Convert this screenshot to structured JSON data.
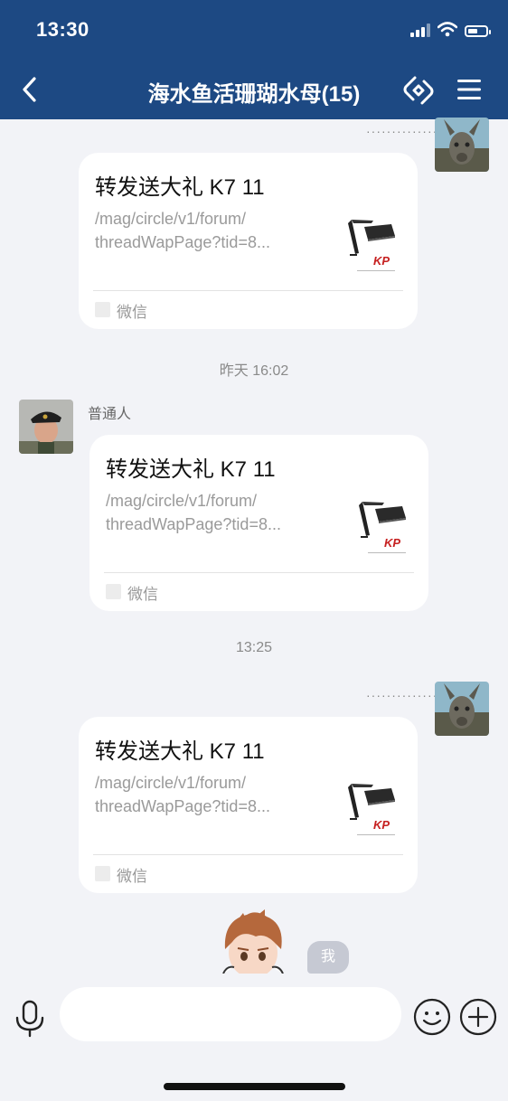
{
  "status_bar": {
    "time": "13:30"
  },
  "nav": {
    "title": "海水鱼活珊瑚水母(15)"
  },
  "messages": [
    {
      "side": "right",
      "card": {
        "title": "转发送大礼 K7 11",
        "desc_line1": "/mag/circle/v1/forum/",
        "desc_line2": "threadWapPage?tid=8...",
        "source": "微信"
      }
    },
    {
      "timestamp": "昨天 16:02"
    },
    {
      "side": "left",
      "sender": "普通人",
      "card": {
        "title": "转发送大礼 K7 11",
        "desc_line1": "/mag/circle/v1/forum/",
        "desc_line2": "threadWapPage?tid=8...",
        "source": "微信"
      }
    },
    {
      "timestamp": "13:25"
    },
    {
      "side": "right",
      "card": {
        "title": "转发送大礼 K7 11",
        "desc_line1": "/mag/circle/v1/forum/",
        "desc_line2": "threadWapPage?tid=8...",
        "source": "微信"
      }
    }
  ],
  "partial_bubble": {
    "text": "我"
  },
  "input": {
    "placeholder": ""
  },
  "colors": {
    "header_bg": "#1d4983",
    "chat_bg": "#f2f3f7",
    "card_bg": "#ffffff"
  }
}
